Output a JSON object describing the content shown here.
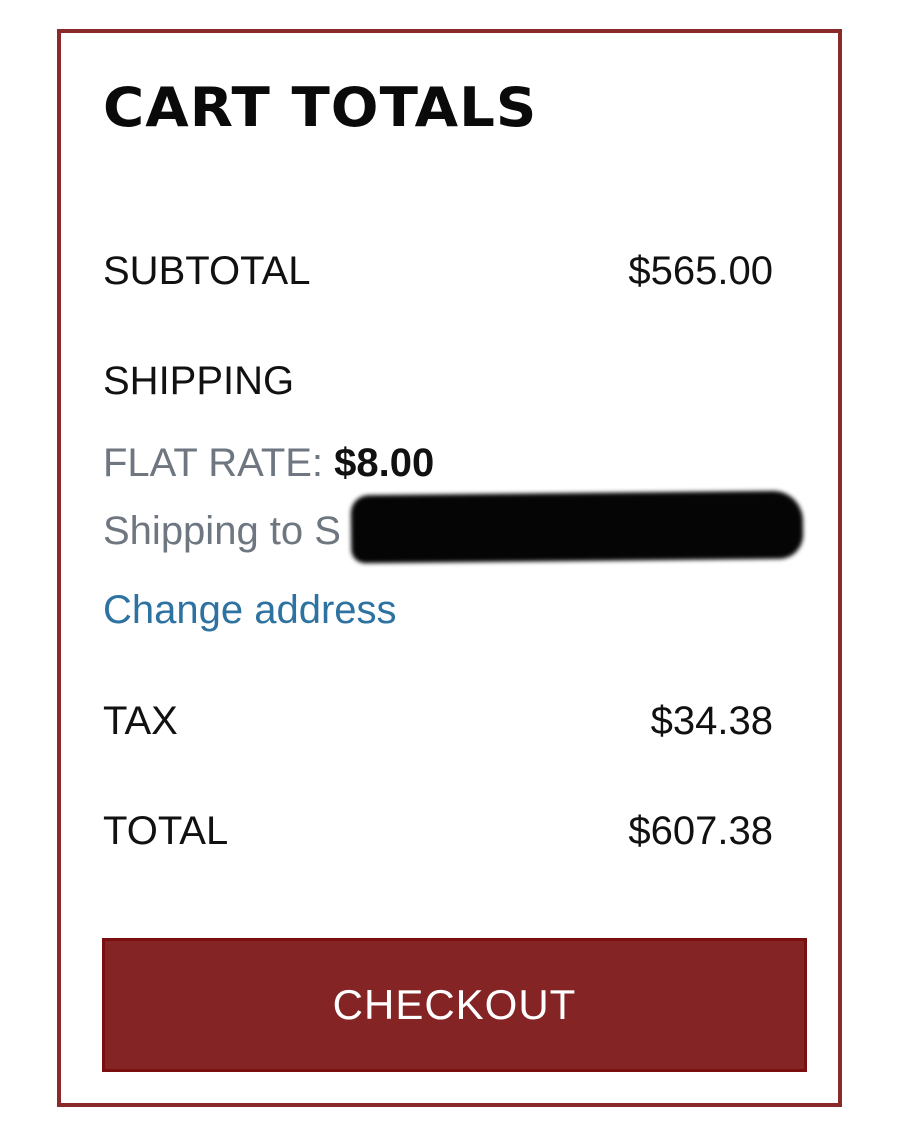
{
  "cart": {
    "title": "CART TOTALS",
    "subtotal": {
      "label": "SUBTOTAL",
      "value": "$565.00"
    },
    "shipping": {
      "label": "SHIPPING",
      "method_label": "FLAT RATE:",
      "method_amount": "$8.00",
      "destination_prefix": "Shipping to S",
      "change_address_label": "Change address"
    },
    "tax": {
      "label": "TAX",
      "value": "$34.38"
    },
    "total": {
      "label": "TOTAL",
      "value": "$607.38"
    },
    "checkout_label": "CHECKOUT"
  },
  "colors": {
    "border": "#8a2a2a",
    "checkout_bg": "#852424",
    "link": "#2d72a0",
    "muted_text": "#6e7680"
  }
}
